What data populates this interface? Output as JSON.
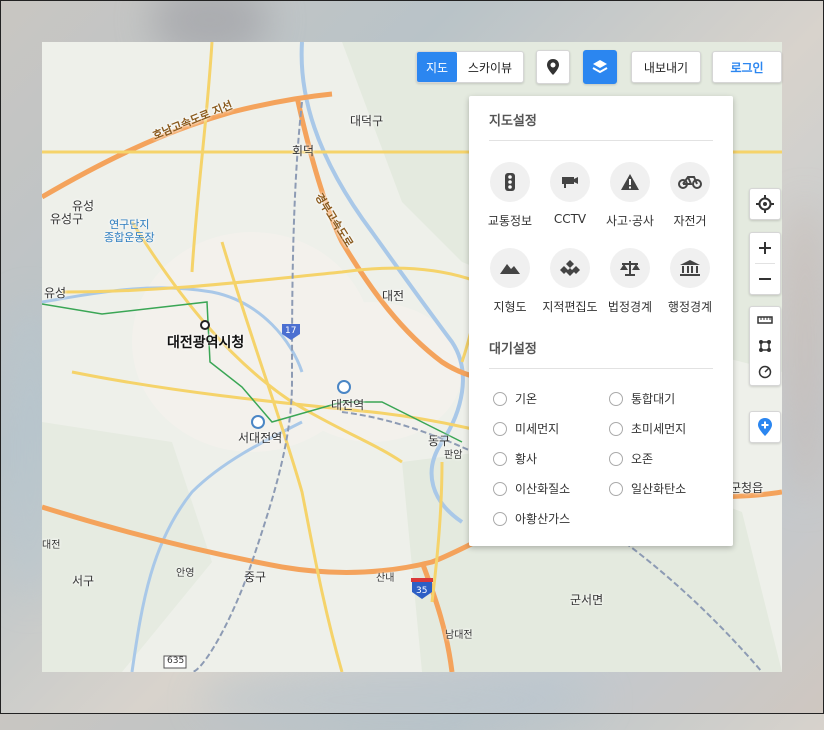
{
  "topbar": {
    "map_label": "지도",
    "skyview_label": "스카이뷰",
    "export_label": "내보내기",
    "login_label": "로그인"
  },
  "panel": {
    "map_settings_title": "지도설정",
    "map_options": [
      {
        "label": "교통정보",
        "icon": "traffic-light-icon"
      },
      {
        "label": "CCTV",
        "icon": "cctv-icon"
      },
      {
        "label": "사고·공사",
        "icon": "warning-icon"
      },
      {
        "label": "자전거",
        "icon": "bicycle-icon"
      },
      {
        "label": "지형도",
        "icon": "mountain-icon"
      },
      {
        "label": "지적편집도",
        "icon": "cadastral-icon"
      },
      {
        "label": "법정경계",
        "icon": "scale-icon"
      },
      {
        "label": "행정경계",
        "icon": "government-building-icon"
      }
    ],
    "air_settings_title": "대기설정",
    "air_options": [
      "기온",
      "통합대기",
      "미세먼지",
      "초미세먼지",
      "황사",
      "오존",
      "이산화질소",
      "일산화탄소",
      "아황산가스"
    ]
  },
  "map": {
    "labels": {
      "daedeok": "대덕구",
      "yuseong_gu": "유성구",
      "yuseong": "유성",
      "yuseong_ic": "유성",
      "hoedeok": "회덕",
      "research": "연구단지\n종합운동장",
      "daejeon_ic": "대전",
      "cityhall": "대전광역시청",
      "daejeon_stn": "대전역",
      "seodaejeon_stn": "서대전역",
      "dong": "동구",
      "panam": "판암",
      "seo_gu": "서구",
      "anyeong": "안영",
      "jung_gu": "중구",
      "sannae": "산내",
      "nam_daejeon": "남대전",
      "gunseo": "군서면",
      "daejeon_left": "대전",
      "geumseong": "군청읍",
      "expressway1": "호남고속도로 지선",
      "expressway2": "경부고속도로"
    },
    "route_numbers": {
      "r17": "17",
      "r35": "35",
      "r635": "635"
    }
  },
  "colors": {
    "accent": "#2b86f0",
    "expressway": "#f4a35c",
    "road": "#f5d36a"
  }
}
